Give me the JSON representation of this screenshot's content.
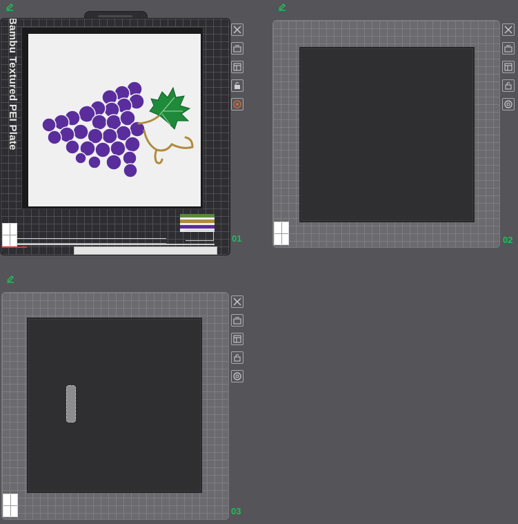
{
  "colors": {
    "background": "#555459",
    "accent": "#1fbf5b",
    "grape": "#5a2d9c",
    "leaf": "#1f8a3a",
    "stem": "#b08a3c"
  },
  "plates": [
    {
      "number": "01",
      "selected": true,
      "bed_label": "Bambu Textured PEI Plate",
      "tools": [
        "delete-icon",
        "arrange-icon",
        "orient-icon",
        "lock-icon",
        "settings-icon"
      ]
    },
    {
      "number": "02",
      "selected": false,
      "tools": [
        "delete-icon",
        "arrange-icon",
        "orient-icon",
        "lock-icon",
        "settings-icon"
      ]
    },
    {
      "number": "03",
      "selected": false,
      "tools": [
        "delete-icon",
        "arrange-icon",
        "orient-icon",
        "lock-icon",
        "settings-icon"
      ]
    }
  ]
}
